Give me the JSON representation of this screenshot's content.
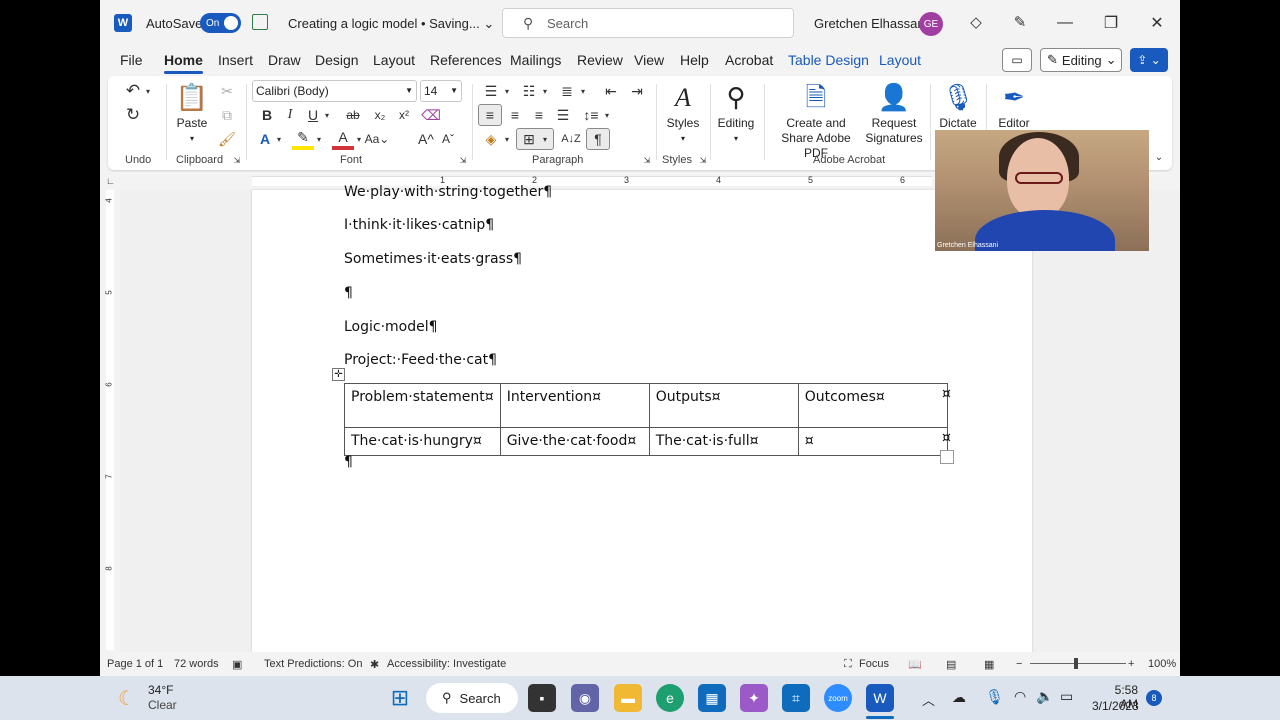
{
  "titlebar": {
    "app_logo": "W",
    "autosave_label": "AutoSave",
    "autosave_state": "On",
    "doc_title": "Creating a logic model • Saving...",
    "search_placeholder": "Search",
    "user_name": "Gretchen Elhassani",
    "user_initials": "GE",
    "icons": [
      "word-icon",
      "save-icon",
      "diamond-icon",
      "pen-icon",
      "minimize-icon",
      "restore-icon",
      "close-icon"
    ]
  },
  "menu": {
    "tabs": [
      "File",
      "Home",
      "Insert",
      "Draw",
      "Design",
      "Layout",
      "References",
      "Mailings",
      "Review",
      "View",
      "Help",
      "Acrobat",
      "Table Design",
      "Layout"
    ],
    "active_tab": "Home",
    "editing_label": "Editing"
  },
  "ribbon": {
    "groups": {
      "undo": "Undo",
      "clipboard": "Clipboard",
      "font": "Font",
      "paragraph": "Paragraph",
      "styles": "Styles",
      "adobe": "Adobe Acrobat"
    },
    "paste_label": "Paste",
    "font_name": "Calibri (Body)",
    "font_size": "14",
    "styles_label": "Styles",
    "editing_label": "Editing",
    "create_share_label": "Create and Share Adobe PDF",
    "request_sig_label": "Request Signatures",
    "dictate_label": "Dictate",
    "editor_label": "Editor"
  },
  "ruler": {
    "numbers": [
      "1",
      "2",
      "3",
      "4",
      "5",
      "6"
    ],
    "vertical_numbers": [
      "4",
      "5",
      "6",
      "7",
      "8"
    ]
  },
  "document": {
    "lines": [
      "We·play·with·string·together¶",
      "I·think·it·likes·catnip¶",
      "Sometimes·it·eats·grass¶",
      "¶",
      "Logic·model¶",
      "Project:·Feed·the·cat¶"
    ],
    "table": {
      "header": [
        "Problem·statement¤",
        "Intervention¤",
        "Outputs¤",
        "Outcomes¤"
      ],
      "row": [
        "The·cat·is·hungry¤",
        "Give·the·cat·food¤",
        "The·cat·is·full¤",
        "¤"
      ],
      "row_end": "¤"
    },
    "after_table": "¶"
  },
  "video": {
    "name": "Gretchen Elhassani"
  },
  "status": {
    "page": "Page 1 of 1",
    "words": "72 words",
    "text_predictions": "Text Predictions: On",
    "accessibility": "Accessibility: Investigate",
    "focus": "Focus",
    "zoom": "100%"
  },
  "taskbar": {
    "temp": "34°F",
    "weather": "Clear",
    "search_label": "Search",
    "time": "5:58 AM",
    "date": "3/1/2023",
    "notifications": "8"
  }
}
